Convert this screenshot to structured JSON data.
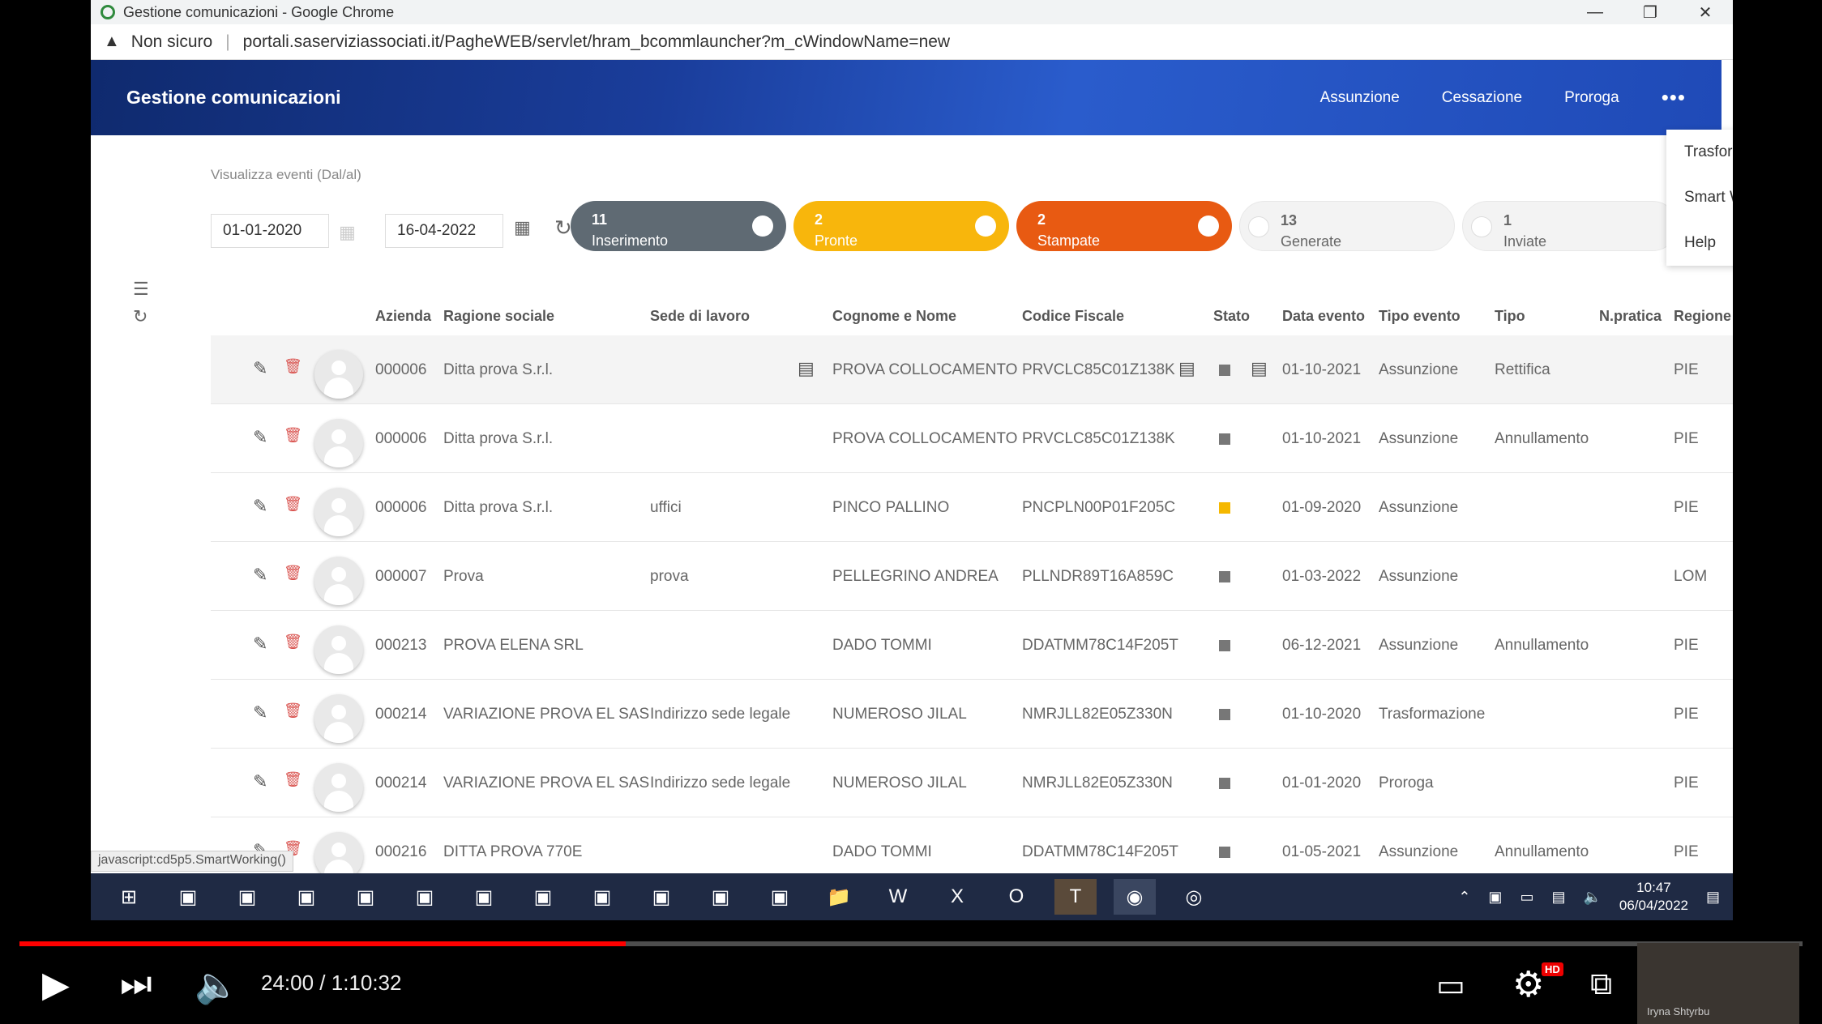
{
  "window": {
    "title": "Gestione comunicazioni - Google Chrome",
    "minimize": "—",
    "restore": "❐",
    "close": "✕"
  },
  "address": {
    "security": "Non sicuro",
    "url": "portali.saserviziassociati.it/PagheWEB/servlet/hram_bcommlauncher?m_cWindowName=new"
  },
  "header": {
    "title": "Gestione comunicazioni",
    "nav": [
      "Assunzione",
      "Cessazione",
      "Proroga"
    ],
    "more": "•••"
  },
  "menu": {
    "items": [
      "Trasformazione",
      "Smart Working",
      "Help"
    ],
    "hovered": "Smart Working"
  },
  "filter": {
    "label": "Visualizza eventi (Dal/al)",
    "from": "01-01-2020",
    "to": "16-04-2022"
  },
  "status_pills": [
    {
      "count": "11",
      "label": "Inserimento",
      "color": "#5f6a73"
    },
    {
      "count": "2",
      "label": "Pronte",
      "color": "#f8b60c"
    },
    {
      "count": "2",
      "label": "Stampate",
      "color": "#e85a12"
    },
    {
      "count": "13",
      "label": "Generate",
      "color": "#f3f3f3"
    },
    {
      "count": "1",
      "label": "Inviate",
      "color": "#f3f3f3"
    }
  ],
  "table": {
    "columns": [
      "Azienda",
      "Ragione sociale",
      "Sede di lavoro",
      "Cognome e Nome",
      "Codice Fiscale",
      "Stato",
      "Data evento",
      "Tipo evento",
      "Tipo",
      "N.pratica",
      "Regione - C.P.I."
    ],
    "rows": [
      {
        "azienda": "000006",
        "ragione": "Ditta prova S.r.l.",
        "sede": "",
        "nome": "PROVA COLLOCAMENTO",
        "cf": "PRVCLC85C01Z138K",
        "stato": "grey",
        "data": "01-10-2021",
        "tipo_evento": "Assunzione",
        "tipo": "Rettifica",
        "npratica": "",
        "regione": "PIE"
      },
      {
        "azienda": "000006",
        "ragione": "Ditta prova S.r.l.",
        "sede": "",
        "nome": "PROVA COLLOCAMENTO",
        "cf": "PRVCLC85C01Z138K",
        "stato": "grey",
        "data": "01-10-2021",
        "tipo_evento": "Assunzione",
        "tipo": "Annullamento",
        "npratica": "",
        "regione": "PIE"
      },
      {
        "azienda": "000006",
        "ragione": "Ditta prova S.r.l.",
        "sede": "uffici",
        "nome": "PINCO PALLINO",
        "cf": "PNCPLN00P01F205C",
        "stato": "yellow",
        "data": "01-09-2020",
        "tipo_evento": "Assunzione",
        "tipo": "",
        "npratica": "",
        "regione": "PIE"
      },
      {
        "azienda": "000007",
        "ragione": "Prova",
        "sede": "prova",
        "nome": "PELLEGRINO ANDREA",
        "cf": "PLLNDR89T16A859C",
        "stato": "grey",
        "data": "01-03-2022",
        "tipo_evento": "Assunzione",
        "tipo": "",
        "npratica": "",
        "regione": "LOM"
      },
      {
        "azienda": "000213",
        "ragione": "PROVA ELENA SRL",
        "sede": "",
        "nome": "DADO TOMMI",
        "cf": "DDATMM78C14F205T",
        "stato": "grey",
        "data": "06-12-2021",
        "tipo_evento": "Assunzione",
        "tipo": "Annullamento",
        "npratica": "",
        "regione": "PIE"
      },
      {
        "azienda": "000214",
        "ragione": "VARIAZIONE PROVA EL SAS",
        "sede": "Indirizzo sede legale",
        "nome": "NUMEROSO JILAL",
        "cf": "NMRJLL82E05Z330N",
        "stato": "grey",
        "data": "01-10-2020",
        "tipo_evento": "Trasformazione",
        "tipo": "",
        "npratica": "",
        "regione": "PIE"
      },
      {
        "azienda": "000214",
        "ragione": "VARIAZIONE PROVA EL SAS",
        "sede": "Indirizzo sede legale",
        "nome": "NUMEROSO JILAL",
        "cf": "NMRJLL82E05Z330N",
        "stato": "grey",
        "data": "01-01-2020",
        "tipo_evento": "Proroga",
        "tipo": "",
        "npratica": "",
        "regione": "PIE"
      },
      {
        "azienda": "000216",
        "ragione": "DITTA PROVA 770E",
        "sede": "",
        "nome": "DADO TOMMI",
        "cf": "DDATMM78C14F205T",
        "stato": "grey",
        "data": "01-05-2021",
        "tipo_evento": "Assunzione",
        "tipo": "Annullamento",
        "npratica": "",
        "regione": "PIE"
      }
    ]
  },
  "status_url": "javascript:cd5p5.SmartWorking()",
  "taskbar": {
    "apps": [
      "windows-start",
      "app-1",
      "app-2",
      "app-3",
      "app-4",
      "app-5",
      "app-6",
      "app-7",
      "app-8",
      "app-9",
      "app-10",
      "app-11",
      "file-explorer",
      "word",
      "excel",
      "outlook",
      "teams",
      "chrome",
      "firefox"
    ],
    "teams_badge": "1",
    "clock_time": "10:47",
    "clock_date": "06/04/2022"
  },
  "video": {
    "time": "24:00 / 1:10:32",
    "played_fraction": 0.34,
    "buffer_fraction": 0.245,
    "hd": "HD",
    "channel": "Iryna Shtyrbu"
  }
}
